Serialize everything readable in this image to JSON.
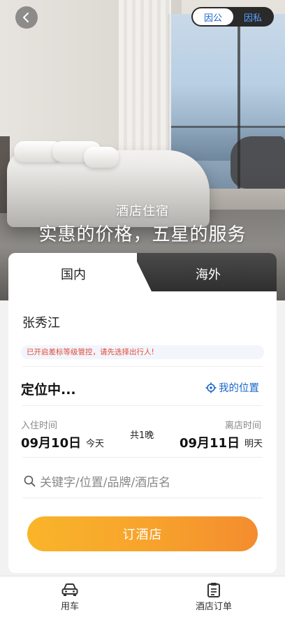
{
  "header": {
    "back_icon": "chevron-left-icon",
    "mode_toggle": {
      "options": [
        "因公",
        "因私"
      ],
      "selected": "因公"
    }
  },
  "hero": {
    "subtitle": "酒店住宿",
    "title": "实惠的价格，五星的服务"
  },
  "tabs": [
    {
      "label": "国内",
      "active": true
    },
    {
      "label": "海外",
      "active": false
    }
  ],
  "form": {
    "traveler": "张秀江",
    "notice": "已开启差标等级管控，请先选择出行人!",
    "location_status": "定位中...",
    "my_location_label": "我的位置",
    "checkin": {
      "label": "入住时间",
      "date": "09月10日",
      "day": "今天"
    },
    "nights": "共1晚",
    "checkout": {
      "label": "离店时间",
      "date": "09月11日",
      "day": "明天"
    },
    "search_placeholder": "关键字/位置/品牌/酒店名",
    "book_button": "订酒店"
  },
  "bottom_nav": [
    {
      "label": "用车",
      "icon": "car-icon"
    },
    {
      "label": "酒店订单",
      "icon": "clipboard-icon"
    }
  ],
  "colors": {
    "accent": "#1a66c9",
    "button_start": "#f9b52a",
    "button_end": "#f48c2f",
    "notice_text": "#e24a3b"
  }
}
